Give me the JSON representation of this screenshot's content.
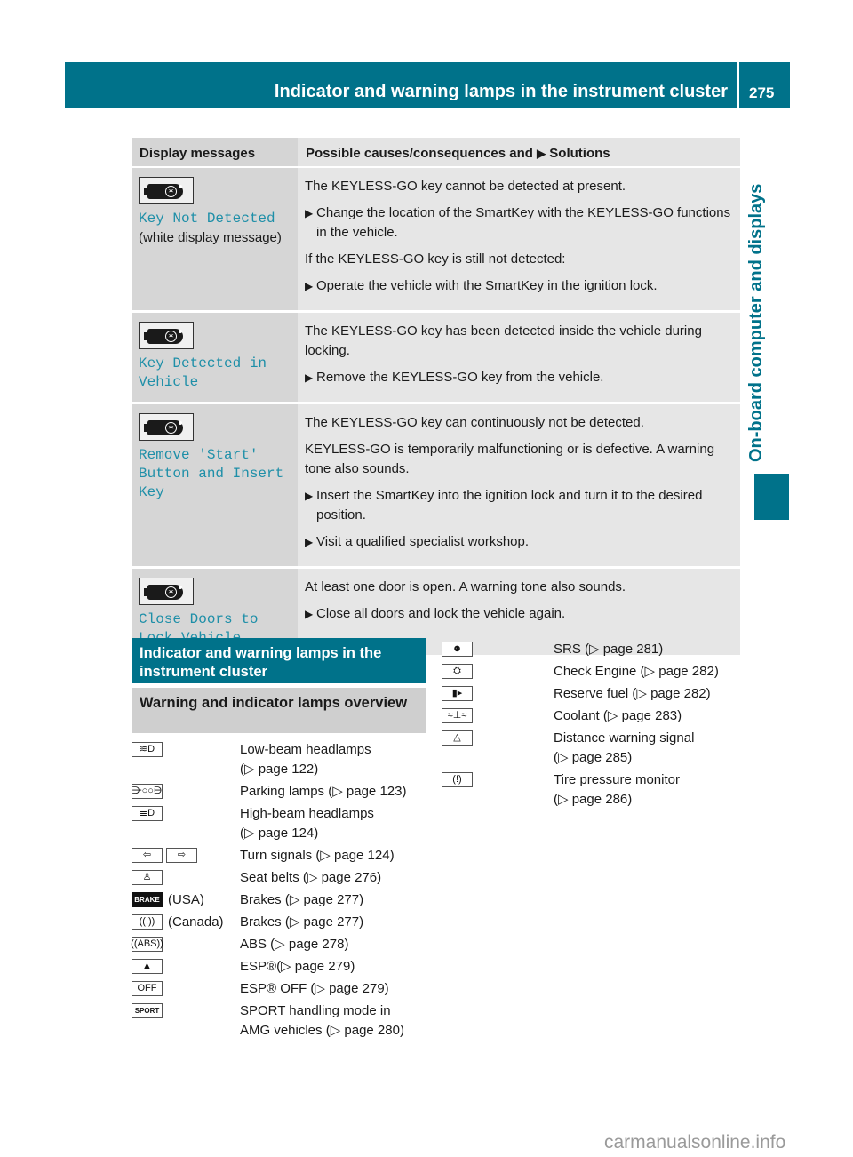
{
  "header": {
    "title": "Indicator and warning lamps in the instrument cluster",
    "page_number": "275"
  },
  "side_tab": {
    "label": "On-board computer and displays"
  },
  "colors": {
    "accent": "#00728a",
    "display_text": "#1e8fa8",
    "table_col1_bg": "#d6d6d6",
    "table_col2_bg": "#e6e6e6",
    "subheading_bg": "#cfcfcf"
  },
  "messages_table": {
    "headers": {
      "col1": "Display messages",
      "col2": "Possible causes/consequences and",
      "col2_arrow": "▶",
      "col2_tail": "Solutions"
    },
    "rows": [
      {
        "icon": "smartkey-icon",
        "display_message": "Key Not Detected",
        "note": "(white display message)",
        "content": [
          {
            "type": "text",
            "text": "The KEYLESS-GO key cannot be detected at present."
          },
          {
            "type": "bullet",
            "text": "Change the location of the SmartKey with the KEYLESS-GO functions in the vehicle."
          },
          {
            "type": "text",
            "text": "If the KEYLESS-GO key is still not detected:"
          },
          {
            "type": "bullet",
            "text": "Operate the vehicle with the SmartKey in the ignition lock."
          }
        ]
      },
      {
        "icon": "smartkey-icon",
        "display_message": "Key Detected in\nVehicle",
        "note": "",
        "content": [
          {
            "type": "text",
            "text": "The KEYLESS-GO key has been detected inside the vehicle during locking."
          },
          {
            "type": "bullet",
            "text": "Remove the KEYLESS-GO key from the vehicle."
          }
        ]
      },
      {
        "icon": "smartkey-icon",
        "display_message": "Remove 'Start'\nButton and Insert\nKey",
        "note": "",
        "content": [
          {
            "type": "text",
            "text": "The KEYLESS-GO key can continuously not be detected."
          },
          {
            "type": "text",
            "text": "KEYLESS-GO is temporarily malfunctioning or is defective. A warning tone also sounds."
          },
          {
            "type": "bullet",
            "text": "Insert the SmartKey into the ignition lock and turn it to the desired position."
          },
          {
            "type": "bullet",
            "text": "Visit a qualified specialist workshop."
          }
        ]
      },
      {
        "icon": "smartkey-icon",
        "display_message": "Close Doors to\nLock Vehicle",
        "note": "",
        "content": [
          {
            "type": "text",
            "text": "At least one door is open. A warning tone also sounds."
          },
          {
            "type": "bullet",
            "text": "Close all doors and lock the vehicle again."
          }
        ]
      }
    ]
  },
  "section": {
    "heading": "Indicator and warning lamps in the instrument cluster",
    "subheading": "Warning and indicator lamps overview"
  },
  "lamps_left": [
    {
      "icons": [
        {
          "name": "low-beam-icon",
          "glyph": "≋D"
        }
      ],
      "qualifier": "",
      "desc": "Low-beam headlamps",
      "ref": "(▷ page 122)"
    },
    {
      "icons": [
        {
          "name": "parking-lamps-icon",
          "glyph": "⋺○○⋻"
        }
      ],
      "qualifier": "",
      "desc": "Parking lamps (▷ page 123)",
      "ref": ""
    },
    {
      "icons": [
        {
          "name": "high-beam-icon",
          "glyph": "≣D"
        }
      ],
      "qualifier": "",
      "desc": "High-beam headlamps",
      "ref": "(▷ page 124)"
    },
    {
      "icons": [
        {
          "name": "turn-signal-left-icon",
          "glyph": "⇦"
        },
        {
          "name": "turn-signal-right-icon",
          "glyph": "⇨"
        }
      ],
      "qualifier": "",
      "desc": "Turn signals (▷ page 124)",
      "ref": ""
    },
    {
      "icons": [
        {
          "name": "seat-belt-icon",
          "glyph": "♙"
        }
      ],
      "qualifier": "",
      "desc": "Seat belts (▷ page 276)",
      "ref": ""
    },
    {
      "icons": [
        {
          "name": "brake-usa-icon",
          "glyph": "BRAKE",
          "style": "filled"
        }
      ],
      "qualifier": "(USA)",
      "desc": "Brakes (▷ page 277)",
      "ref": ""
    },
    {
      "icons": [
        {
          "name": "brake-canada-icon",
          "glyph": "((!))"
        }
      ],
      "qualifier": "(Canada)",
      "desc": "Brakes (▷ page 277)",
      "ref": ""
    },
    {
      "icons": [
        {
          "name": "abs-icon",
          "glyph": "((ABS))"
        }
      ],
      "qualifier": "",
      "desc": "ABS (▷ page 278)",
      "ref": ""
    },
    {
      "icons": [
        {
          "name": "esp-icon",
          "glyph": "▲"
        }
      ],
      "qualifier": "",
      "desc": "ESP®(▷ page 279)",
      "ref": ""
    },
    {
      "icons": [
        {
          "name": "esp-off-icon",
          "glyph": "OFF"
        }
      ],
      "qualifier": "",
      "desc": "ESP® OFF (▷ page 279)",
      "ref": ""
    },
    {
      "icons": [
        {
          "name": "sport-mode-icon",
          "glyph": "SPORT",
          "style": "sport"
        }
      ],
      "qualifier": "",
      "desc": "SPORT handling mode in",
      "ref": "AMG vehicles (▷ page 280)"
    }
  ],
  "lamps_right": [
    {
      "icons": [
        {
          "name": "srs-airbag-icon",
          "glyph": "☻"
        }
      ],
      "qualifier": "",
      "desc": "SRS (▷ page 281)",
      "ref": ""
    },
    {
      "icons": [
        {
          "name": "check-engine-icon",
          "glyph": "⛭"
        }
      ],
      "qualifier": "",
      "desc": "Check Engine (▷ page 282)",
      "ref": ""
    },
    {
      "icons": [
        {
          "name": "reserve-fuel-icon",
          "glyph": "▮▸"
        }
      ],
      "qualifier": "",
      "desc": "Reserve fuel (▷ page 282)",
      "ref": ""
    },
    {
      "icons": [
        {
          "name": "coolant-icon",
          "glyph": "≈⊥≈"
        }
      ],
      "qualifier": "",
      "desc": "Coolant (▷ page 283)",
      "ref": ""
    },
    {
      "icons": [
        {
          "name": "distance-warning-icon",
          "glyph": "△"
        }
      ],
      "qualifier": "",
      "desc": "Distance warning signal",
      "ref": "(▷ page 285)"
    },
    {
      "icons": [
        {
          "name": "tire-pressure-icon",
          "glyph": "(!)"
        }
      ],
      "qualifier": "",
      "desc": "Tire pressure monitor",
      "ref": "(▷ page 286)"
    }
  ],
  "watermark": "carmanualsonline.info"
}
